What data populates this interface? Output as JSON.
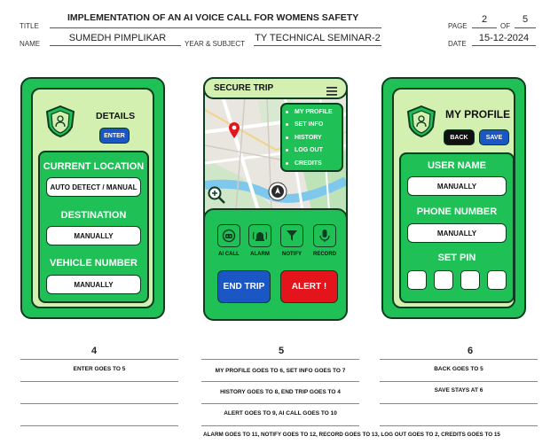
{
  "header": {
    "title_label": "TITLE",
    "title": "IMPLEMENTATION OF AN AI VOICE CALL FOR WOMENS SAFETY",
    "name_label": "NAME",
    "name": "SUMEDH PIMPLIKAR",
    "year_label": "YEAR & SUBJECT",
    "year_subject": "TY TECHNICAL SEMINAR-2",
    "page_label": "PAGE",
    "page": "2",
    "of_label": "OF",
    "total": "5",
    "date_label": "DATE",
    "date": "15-12-2024"
  },
  "screen4": {
    "title": "DETAILS",
    "enter": "ENTER",
    "current_location": "CURRENT LOCATION",
    "current_location_value": "AUTO DETECT / MANUAL",
    "destination": "DESTINATION",
    "destination_value": "MANUALLY",
    "vehicle_number": "VEHICLE NUMBER",
    "vehicle_number_value": "MANUALLY"
  },
  "screen5": {
    "title": "SECURE TRIP",
    "menu": [
      "MY PROFILE",
      "SET INFO",
      "HISTORY",
      "LOG OUT",
      "CREDITS"
    ],
    "actions": [
      "AI CALL",
      "ALARM",
      "NOTIFY",
      "RECORD"
    ],
    "end_trip": "END TRIP",
    "alert": "ALERT !"
  },
  "screen6": {
    "title": "MY PROFILE",
    "back": "BACK",
    "save": "SAVE",
    "user_name": "USER NAME",
    "user_name_value": "MANUALLY",
    "phone_number": "PHONE NUMBER",
    "phone_number_value": "MANUALLY",
    "set_pin": "SET PIN"
  },
  "notes": {
    "n4": "4",
    "n5": "5",
    "n6": "6",
    "col4": [
      "ENTER GOES TO 5"
    ],
    "col5": [
      "MY PROFILE GOES TO 6,   SET INFO GOES TO 7",
      "HISTORY GOES TO 8,    END TRIP GOES TO 4",
      "ALERT GOES TO 9,     AI CALL GOES TO 10",
      "ALARM GOES TO 11,  NOTIFY GOES TO 12,     RECORD GOES TO 13,   LOG OUT GOES TO 2,   CREDITS GOES TO 15"
    ],
    "col6": [
      "BACK GOES TO 5",
      "SAVE STAYS AT 6"
    ]
  },
  "colors": {
    "green": "#1fc157",
    "light_green": "#d4f0b0",
    "dark": "#0d3d20",
    "blue": "#1a56c4",
    "red": "#e3141b"
  },
  "icons": [
    "shield-person-icon",
    "hamburger-menu-icon",
    "map-pin-icon",
    "zoom-icon",
    "compass-icon",
    "robot-icon",
    "alarm-icon",
    "notify-icon",
    "microphone-icon"
  ]
}
